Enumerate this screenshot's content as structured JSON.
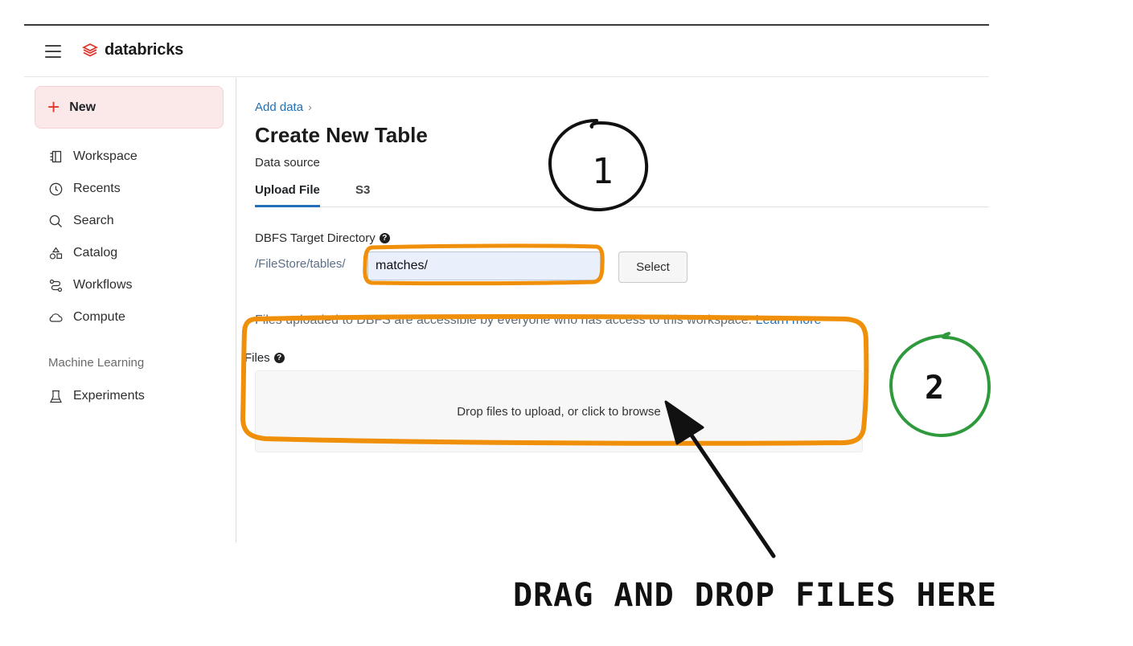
{
  "topbar": {
    "brand": "databricks"
  },
  "sidebar": {
    "new_label": "New",
    "items": [
      {
        "label": "Workspace",
        "icon": "workspace-icon"
      },
      {
        "label": "Recents",
        "icon": "clock-icon"
      },
      {
        "label": "Search",
        "icon": "search-icon"
      },
      {
        "label": "Catalog",
        "icon": "catalog-icon"
      },
      {
        "label": "Workflows",
        "icon": "workflows-icon"
      },
      {
        "label": "Compute",
        "icon": "cloud-icon"
      }
    ],
    "section_ml": "Machine Learning",
    "experiments_label": "Experiments"
  },
  "main": {
    "breadcrumb": "Add data",
    "breadcrumb_sep": "›",
    "title": "Create New Table",
    "data_source_label": "Data source",
    "tabs": [
      {
        "label": "Upload File"
      },
      {
        "label": "S3"
      }
    ],
    "dbfs_label": "DBFS Target Directory",
    "dbfs_prefix": "/FileStore/tables/",
    "dbfs_value": "matches/",
    "select_label": "Select",
    "note_text": "Files uploaded to DBFS are accessible by everyone who has access to this workspace.",
    "learn_more": "Learn more",
    "files_label": "Files",
    "dropzone_text": "Drop files to upload, or click to browse"
  },
  "annotations": {
    "marker_1": "1",
    "marker_2": "2",
    "caption": "DRAG AND DROP FILES HERE",
    "highlight_color": "#f0900a",
    "marker_2_color": "#2e9a3c"
  },
  "colors": {
    "brand": "#e0352b",
    "link": "#2270b8",
    "new_bg": "#fbe9ea"
  }
}
